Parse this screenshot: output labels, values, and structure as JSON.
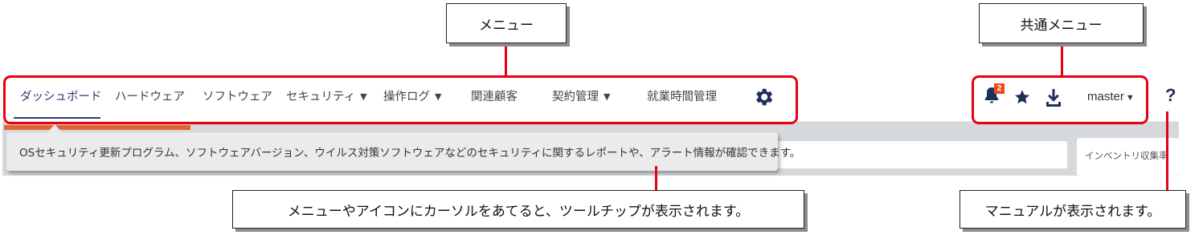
{
  "nav": {
    "items": [
      {
        "label": "ダッシュボード",
        "active": true
      },
      {
        "label": "ハードウェア"
      },
      {
        "label": "ソフトウェア"
      },
      {
        "label": "セキュリティ",
        "dropdown": true
      },
      {
        "label": "操作ログ",
        "dropdown": true
      },
      {
        "label": "関連顧客"
      },
      {
        "label": "契約管理",
        "dropdown": true
      },
      {
        "label": "就業時間管理"
      }
    ],
    "settings_icon": "gear-icon",
    "accent_color": "#2c3e6e"
  },
  "common": {
    "notification_icon": "bell-icon",
    "notification_count": "2",
    "favorite_icon": "star-icon",
    "download_icon": "download-icon",
    "user": "master",
    "help_icon": "?",
    "badge_color": "#e84c1c"
  },
  "tooltip": {
    "text": "OSセキュリティ更新プログラム、ソフトウェアバージョン、ウイルス対策ソフトウェアなどのセキュリティに関するレポートや、アラート情報が確認できます。"
  },
  "widget": {
    "inventory_label": "インベントリ収集率"
  },
  "annotations": {
    "menu_label": "メニュー",
    "common_menu_label": "共通メニュー",
    "tooltip_note": "メニューやアイコンにカーソルをあてると、ツールチップが表示されます。",
    "manual_note": "マニュアルが表示されます。",
    "highlight_color": "#e60012"
  }
}
